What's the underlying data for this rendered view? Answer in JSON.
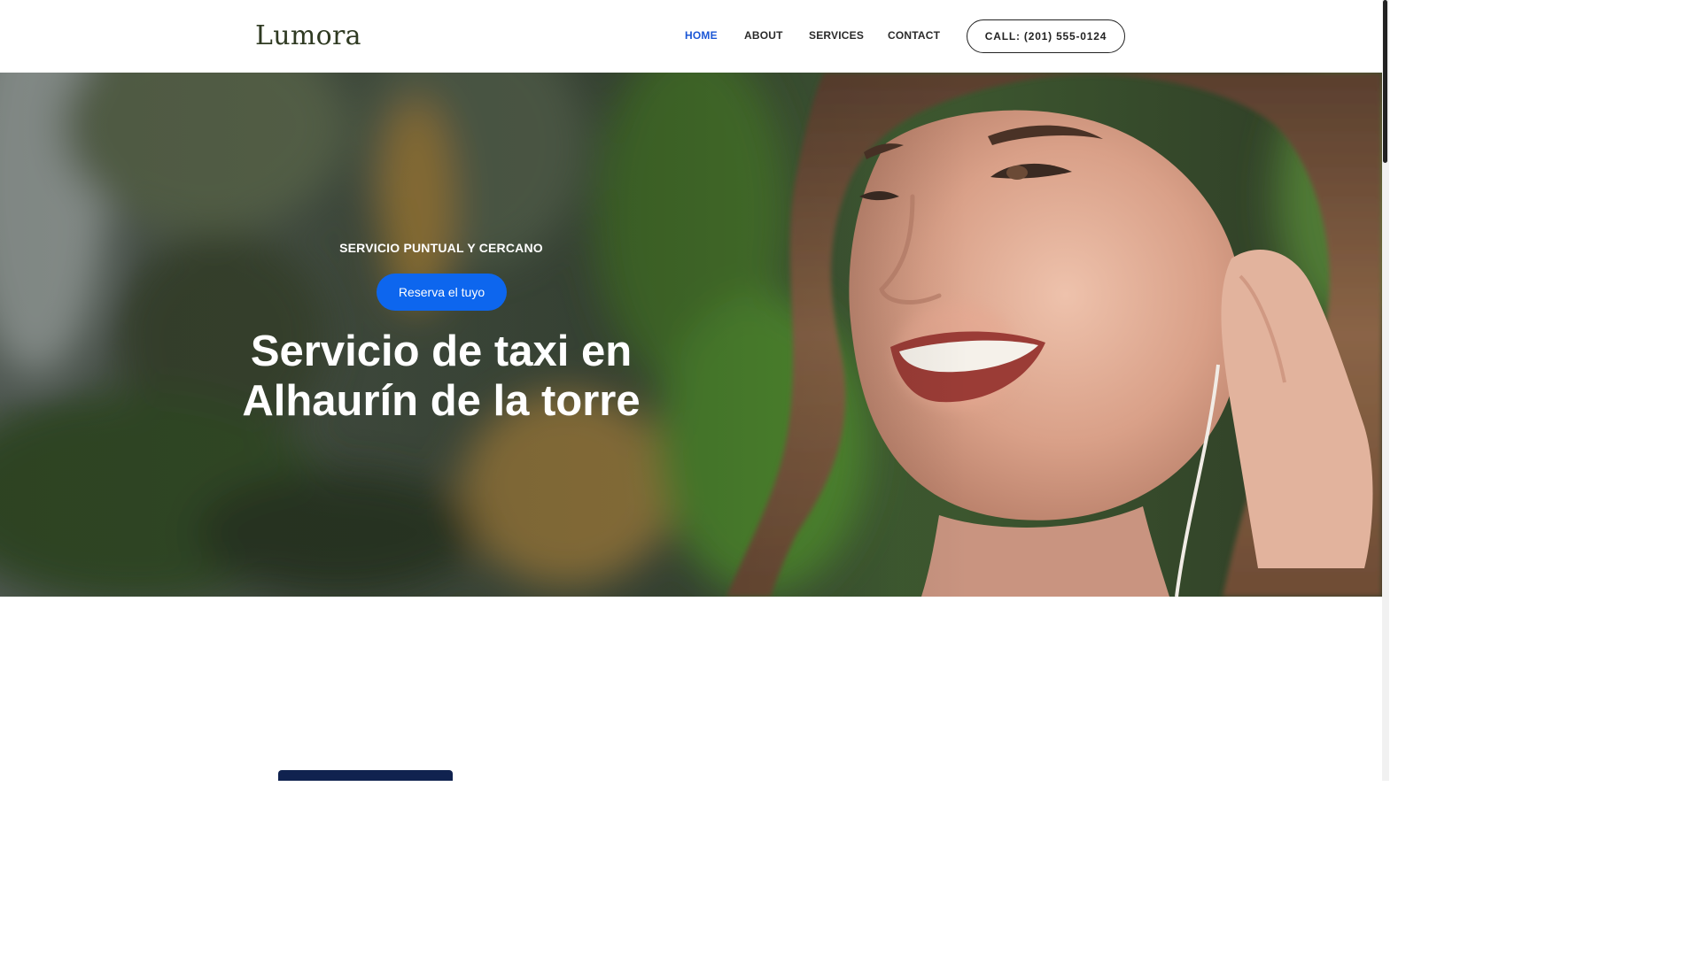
{
  "header": {
    "logo": "Lumora",
    "nav": [
      {
        "label": "HOME",
        "active": true
      },
      {
        "label": "ABOUT",
        "active": false
      },
      {
        "label": "SERVICES",
        "active": false
      },
      {
        "label": "CONTACT",
        "active": false
      }
    ],
    "call_button": "CALL: (201) 555-0124"
  },
  "hero": {
    "kicker": "SERVICIO PUNTUAL Y CERCANO",
    "cta": "Reserva el tuyo",
    "headline_line1": "Servicio de taxi en",
    "headline_line2": "Alhaurín de la torre"
  },
  "colors": {
    "accent": "#0d66ee",
    "nav_active": "#1b57d6",
    "logo": "#2f3a22",
    "dark_card": "#10224f"
  }
}
